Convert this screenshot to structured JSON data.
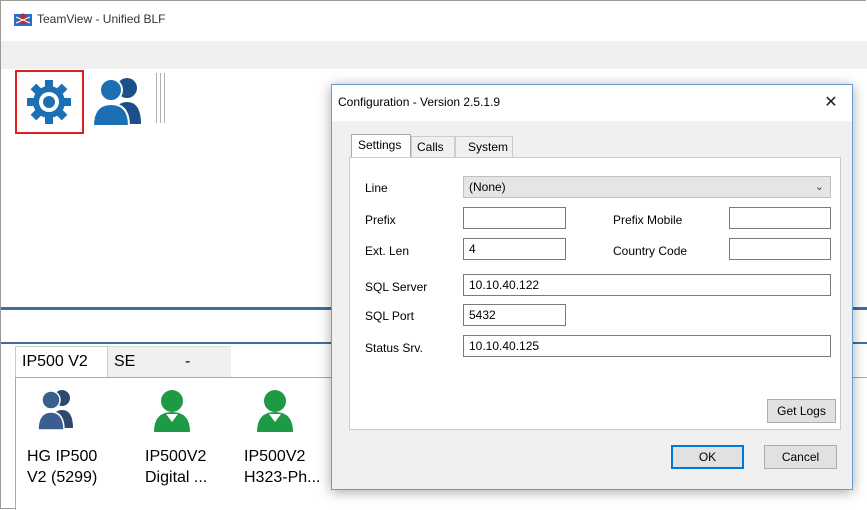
{
  "window": {
    "title": "TeamView - Unified BLF"
  },
  "toolbar": {
    "settings_icon": "gear-icon",
    "users_icon": "people-icon"
  },
  "tabs": [
    {
      "label": "IP500 V2"
    },
    {
      "label": "SE"
    },
    {
      "label": "-"
    }
  ],
  "devices": [
    {
      "label_line1": "HG IP500",
      "label_line2": "V2 (5299)",
      "icon": "group-icon",
      "color": "#2d4a6e"
    },
    {
      "label_line1": "IP500V2",
      "label_line2": "Digital ...",
      "icon": "user-icon",
      "color": "#1e9a45"
    },
    {
      "label_line1": "IP500V2",
      "label_line2": "H323-Ph...",
      "icon": "user-icon",
      "color": "#1e9a45"
    }
  ],
  "dialog": {
    "title": "Configuration - Version 2.5.1.9",
    "close": "✕",
    "tabs": [
      {
        "label": "Settings"
      },
      {
        "label": "Calls"
      },
      {
        "label": "System"
      }
    ],
    "fields": {
      "line": {
        "label": "Line",
        "value": "(None)"
      },
      "prefix": {
        "label": "Prefix",
        "value": ""
      },
      "prefix_mobile": {
        "label": "Prefix Mobile",
        "value": ""
      },
      "ext_len": {
        "label": "Ext. Len",
        "value": "4"
      },
      "country_code": {
        "label": "Country Code",
        "value": ""
      },
      "sql_server": {
        "label": "SQL Server",
        "value": "10.10.40.122"
      },
      "sql_port": {
        "label": "SQL Port",
        "value": "5432"
      },
      "status_srv": {
        "label": "Status Srv.",
        "value": "10.10.40.125"
      }
    },
    "get_logs": "Get Logs",
    "ok": "OK",
    "cancel": "Cancel"
  },
  "colors": {
    "accent_blue": "#3c6ea0",
    "highlight_red": "#e02020",
    "icon_blue": "#1a6fb5",
    "user_green": "#1e9a45"
  }
}
